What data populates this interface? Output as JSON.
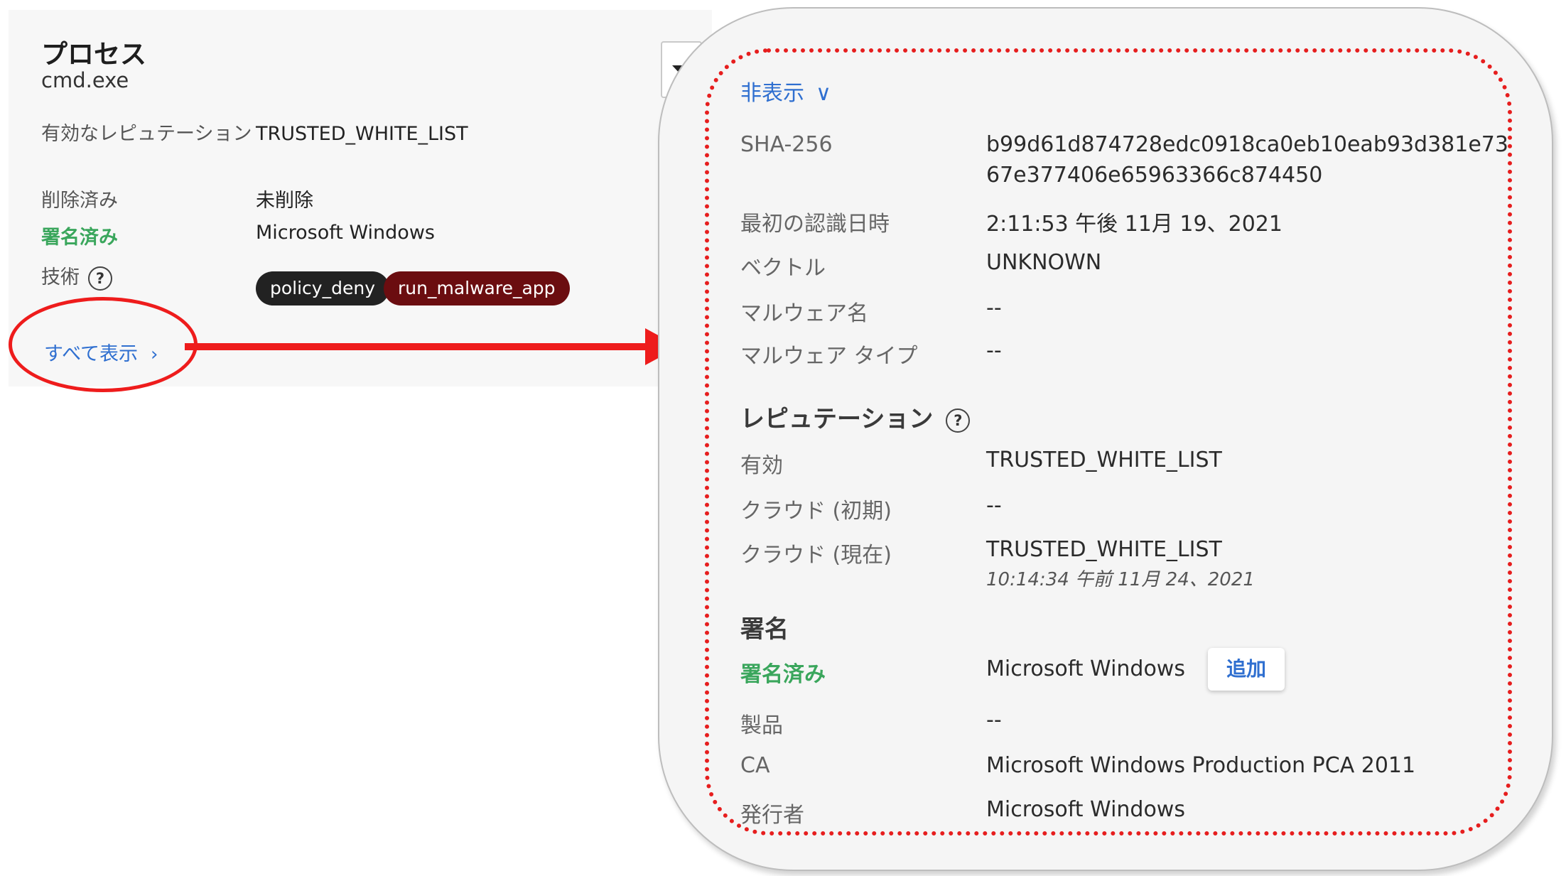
{
  "left_panel": {
    "title": "プロセス",
    "subtitle": "cmd.exe",
    "rows": [
      {
        "label": "有効なレピュテーション",
        "value": "TRUSTED_WHITE_LIST"
      },
      {
        "label": "削除済み",
        "value": "未削除"
      },
      {
        "label": "署名済み",
        "value": "Microsoft Windows"
      },
      {
        "label": "技術",
        "help_icon": "?"
      }
    ],
    "tags": [
      "policy_deny",
      "run_malware_app"
    ],
    "show_all": "すべて表示",
    "show_all_icon": "chevron-right-icon",
    "dropdown_icon": "caret-down-icon"
  },
  "detail_panel": {
    "hide_link": "非表示",
    "hide_icon": "chevron-down-icon",
    "file_rows": [
      {
        "label": "SHA-256",
        "value": "b99d61d874728edc0918ca0eb10eab93d381e7367e377406e65963366c874450"
      },
      {
        "label": "最初の認識日時",
        "value": "2:11:53 午後 11月 19、2021"
      },
      {
        "label": "ベクトル",
        "value": "UNKNOWN"
      },
      {
        "label": "マルウェア名",
        "value": "--"
      },
      {
        "label": "マルウェア タイプ",
        "value": "--"
      }
    ],
    "reputation": {
      "heading": "レピュテーション",
      "help_icon": "?",
      "rows": [
        {
          "label": "有効",
          "value": "TRUSTED_WHITE_LIST"
        },
        {
          "label": "クラウド (初期)",
          "value": "--"
        },
        {
          "label": "クラウド (現在)",
          "value": "TRUSTED_WHITE_LIST",
          "sub": "10:14:34 午前 11月 24、2021"
        }
      ]
    },
    "signature": {
      "heading": "署名",
      "rows": [
        {
          "label": "署名済み",
          "value": "Microsoft Windows",
          "button": "追加"
        },
        {
          "label": "製品",
          "value": "--"
        },
        {
          "label": "CA",
          "value": "Microsoft Windows Production PCA 2011"
        },
        {
          "label": "発行者",
          "value": "Microsoft Windows"
        }
      ]
    }
  },
  "colors": {
    "accent_link": "#2f6fd0",
    "signed_green": "#3aa65c",
    "annotation_red": "#ee1c1c",
    "tag_dark": "#222222",
    "tag_malware": "#6b0d10"
  }
}
